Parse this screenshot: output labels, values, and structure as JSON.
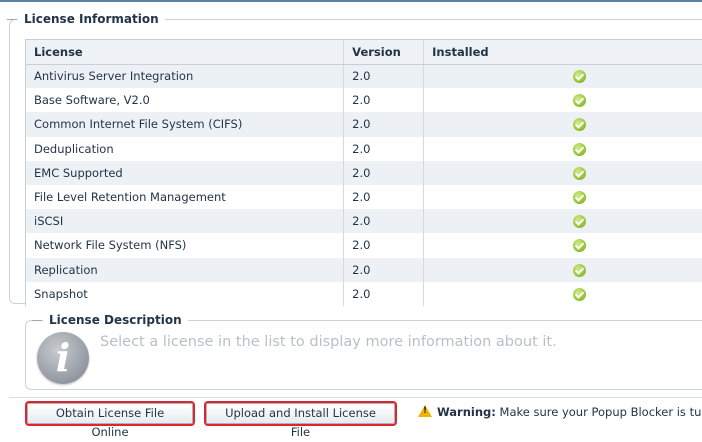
{
  "license_info": {
    "legend": "License Information",
    "columns": {
      "license": "License",
      "version": "Version",
      "installed": "Installed"
    },
    "rows": [
      {
        "license": "Antivirus Server Integration",
        "version": "2.0",
        "installed": true
      },
      {
        "license": "Base Software, V2.0",
        "version": "2.0",
        "installed": true
      },
      {
        "license": "Common Internet File System (CIFS)",
        "version": "2.0",
        "installed": true
      },
      {
        "license": "Deduplication",
        "version": "2.0",
        "installed": true
      },
      {
        "license": "EMC Supported",
        "version": "2.0",
        "installed": true
      },
      {
        "license": "File Level Retention Management",
        "version": "2.0",
        "installed": true
      },
      {
        "license": "iSCSI",
        "version": "2.0",
        "installed": true
      },
      {
        "license": "Network File System (NFS)",
        "version": "2.0",
        "installed": true
      },
      {
        "license": "Replication",
        "version": "2.0",
        "installed": true
      },
      {
        "license": "Snapshot",
        "version": "2.0",
        "installed": true
      }
    ]
  },
  "license_description": {
    "legend": "License Description",
    "icon": "info-icon",
    "text": "Select a license in the list to display more information about it."
  },
  "actions": {
    "obtain_label": "Obtain License File Online",
    "upload_label": "Upload and Install License File",
    "warning_label": "Warning:",
    "warning_text": "Make sure your Popup Blocker is tur"
  },
  "colors": {
    "accent": "#5f7fa3",
    "highlight_outline": "#e0242a",
    "installed_check": "#9bc93a",
    "row_alt": "#edf1f6"
  }
}
